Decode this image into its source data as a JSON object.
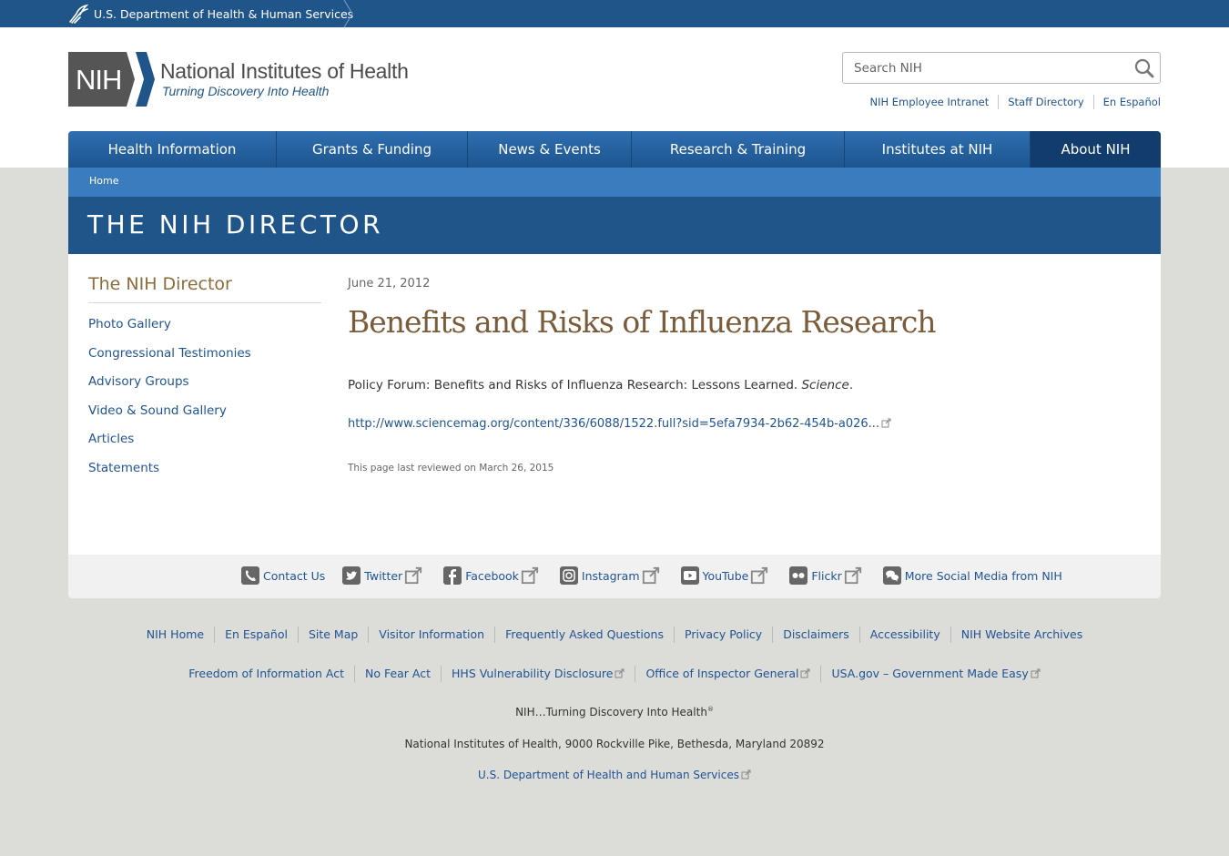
{
  "hhs_bar": {
    "label": "U.S. Department of Health & Human Services"
  },
  "logo": {
    "acronym": "NIH",
    "title": "National Institutes of Health",
    "tagline": "Turning Discovery Into Health"
  },
  "search": {
    "placeholder": "Search NIH"
  },
  "util_links": [
    "NIH Employee Intranet",
    "Staff Directory",
    "En Español"
  ],
  "nav": {
    "items": [
      "Health Information",
      "Grants & Funding",
      "News & Events",
      "Research & Training",
      "Institutes at NIH",
      "About NIH"
    ],
    "active": "About NIH"
  },
  "breadcrumb": [
    "Home"
  ],
  "banner": {
    "title": "THE NIH DIRECTOR"
  },
  "sidebar": {
    "title": "The NIH Director",
    "items": [
      "Photo Gallery",
      "Congressional Testimonies",
      "Advisory Groups",
      "Video & Sound Gallery",
      "Articles",
      "Statements"
    ]
  },
  "article": {
    "date": "June 21, 2012",
    "title": "Benefits and Risks of Influenza Research",
    "description": "Policy Forum: Benefits and Risks of Influenza Research: Lessons Learned.",
    "journal": "Science",
    "description_end": ".",
    "link": "http://www.sciencemag.org/content/336/6088/1522.full?sid=5efa7934-2b62-454b-a026...",
    "reviewed": "This page last reviewed on March 26, 2015"
  },
  "social": [
    "Contact Us",
    "Twitter",
    "Facebook",
    "Instagram",
    "YouTube",
    "Flickr",
    "More Social Media from NIH"
  ],
  "footer": {
    "row1": [
      "NIH Home",
      "En Español",
      "Site Map",
      "Visitor Information",
      "Frequently Asked Questions",
      "Privacy Policy",
      "Disclaimers",
      "Accessibility",
      "NIH Website Archives"
    ],
    "row2": [
      "Freedom of Information Act",
      "No Fear Act",
      "HHS Vulnerability Disclosure",
      "Office of Inspector General",
      "USA.gov – Government Made Easy"
    ],
    "tagline": "NIH…Turning Discovery Into Health",
    "tagline_mark": "®",
    "address": "National Institutes of Health, 9000 Rockville Pike, Bethesda, Maryland 20892",
    "hhs": "U.S. Department of Health and Human Services"
  },
  "colors": {
    "hhs_bar": "#20558a",
    "nav": "#205493",
    "nav_active": "#123c6b",
    "breadcrumb": "#3b7cbe",
    "link": "#205493",
    "title_brown": "#7a5c3a",
    "sidebar_title": "#8a6d3b",
    "page_bg": "#dcdcd8"
  }
}
